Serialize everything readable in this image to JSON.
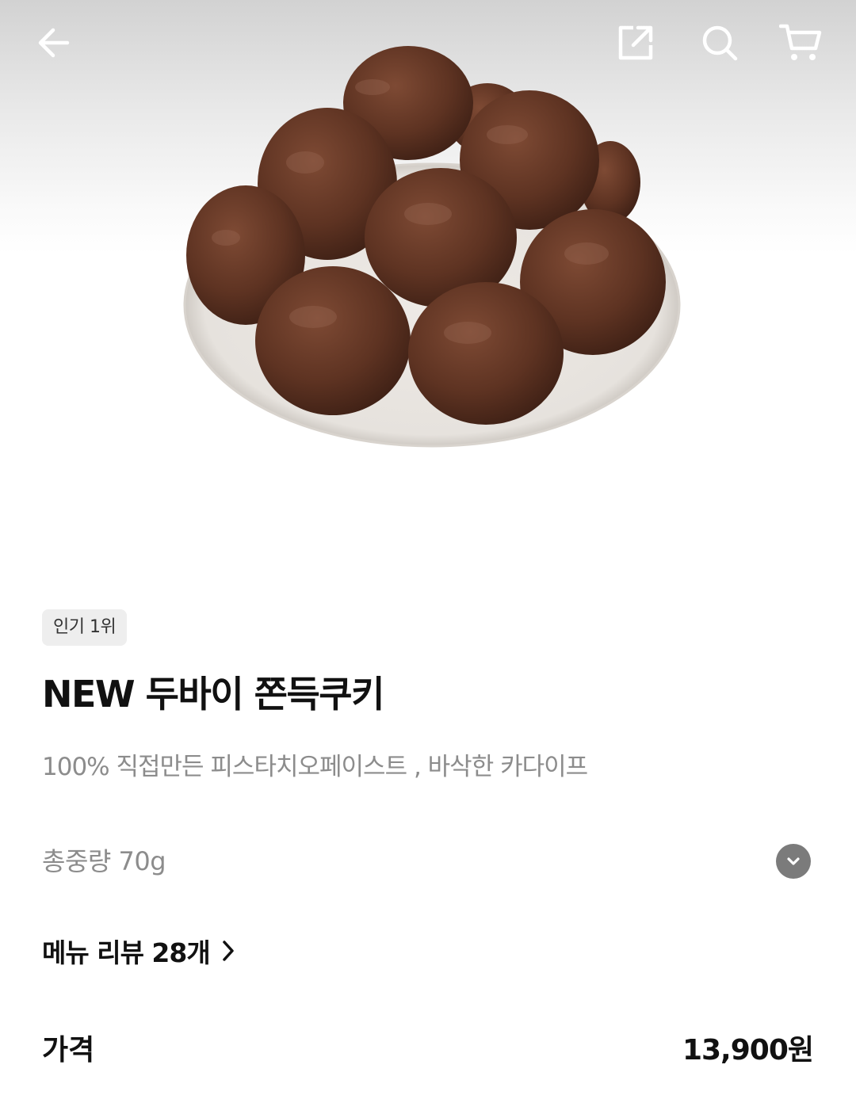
{
  "product": {
    "badge": "인기 1위",
    "title": "NEW 두바이 쫀득쿠키",
    "description": "100% 직접만든 피스타치오페이스트 , 바삭한 카다이프",
    "weight": "총중량 70g",
    "reviews_link": "메뉴 리뷰 28개",
    "price_label": "가격",
    "price": "13,900원"
  },
  "icons": {
    "back": "arrow-left-icon",
    "share": "share-icon",
    "search": "search-icon",
    "cart": "cart-icon",
    "expand": "chevron-down-icon",
    "review_chevron": "chevron-right-icon"
  },
  "colors": {
    "title_text": "#111111",
    "secondary_text": "#8c8c8c",
    "badge_bg": "#eeeeee",
    "expand_button_bg": "#7b7b7b"
  }
}
